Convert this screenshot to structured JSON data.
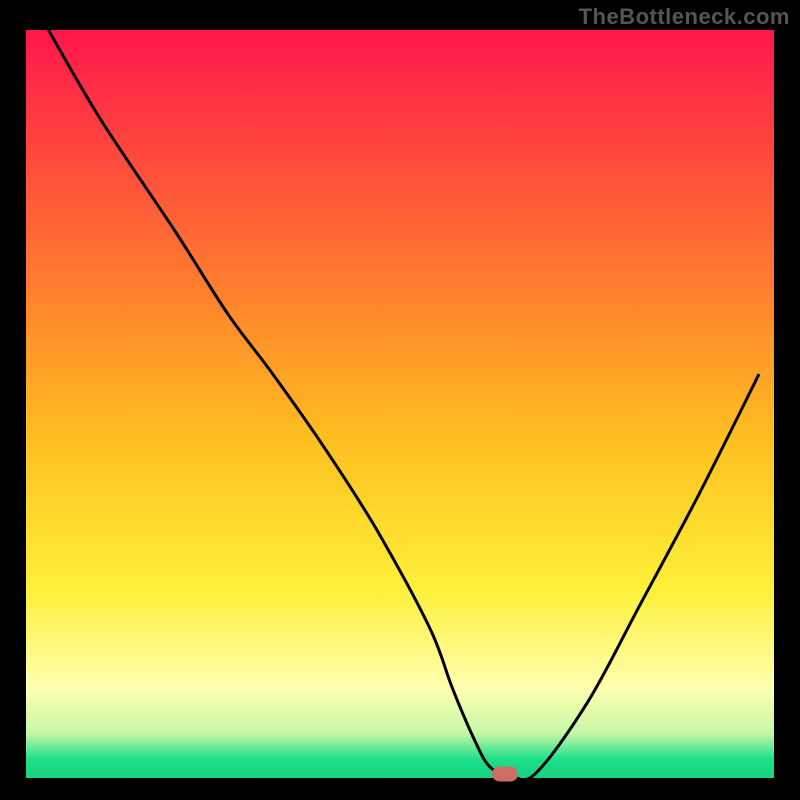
{
  "watermark": "TheBottleneck.com",
  "colors": {
    "gradient_top": "#ff174b",
    "gradient_mid1": "#ff8a2a",
    "gradient_mid2": "#ffe321",
    "gradient_pale": "#ffffb3",
    "gradient_green": "#1ee08a",
    "line": "#000000",
    "marker": "#cf6c66",
    "background": "#000000"
  },
  "chart_data": {
    "type": "line",
    "title": "",
    "xlabel": "",
    "ylabel": "",
    "xlim": [
      0,
      100
    ],
    "ylim": [
      0,
      100
    ],
    "x": [
      3,
      10,
      20,
      27,
      33,
      40,
      47,
      54,
      57,
      60,
      62,
      64.5,
      68,
      75,
      82,
      90,
      98
    ],
    "y": [
      100,
      88,
      73,
      62,
      54,
      44,
      33,
      20,
      12,
      5,
      1.5,
      0.5,
      0.5,
      10,
      23,
      38,
      54
    ],
    "marker": {
      "x": 64,
      "y": 0.5
    },
    "gradient_stops": [
      {
        "offset": 0.0,
        "color": "#ff174b"
      },
      {
        "offset": 0.28,
        "color": "#ff6a33"
      },
      {
        "offset": 0.55,
        "color": "#ffc01f"
      },
      {
        "offset": 0.75,
        "color": "#fff03a"
      },
      {
        "offset": 0.88,
        "color": "#ffffb0"
      },
      {
        "offset": 0.94,
        "color": "#c6f7a6"
      },
      {
        "offset": 0.975,
        "color": "#1ee08a"
      },
      {
        "offset": 1.0,
        "color": "#17d183"
      }
    ]
  }
}
